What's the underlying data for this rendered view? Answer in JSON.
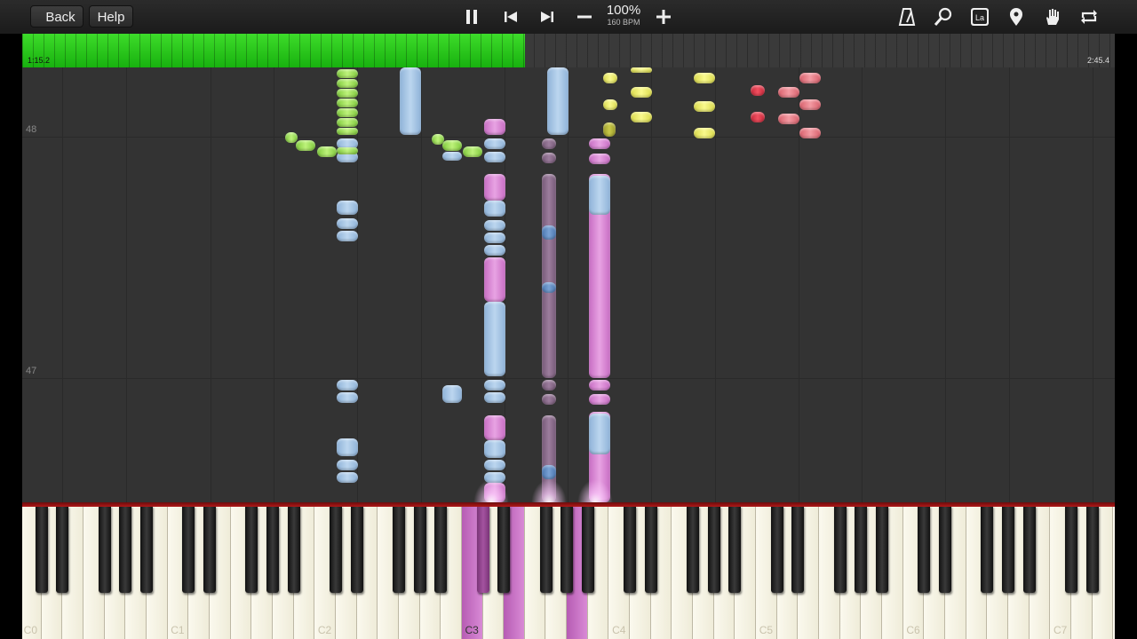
{
  "toolbar": {
    "back_label": "Back",
    "help_label": "Help",
    "tempo_percent": "100%",
    "tempo_bpm": "160 BPM",
    "icons": [
      "pause-icon",
      "skip-back-icon",
      "skip-forward-icon",
      "minus-icon",
      "plus-icon",
      "metronome-icon",
      "search-icon",
      "la-key-icon",
      "location-pin-icon",
      "hand-icon",
      "loop-icon"
    ],
    "la_label": "La"
  },
  "progress": {
    "current_time": "1:15.2",
    "total_time": "2:45.4",
    "fraction": 0.46
  },
  "roll": {
    "measure_numbers": [
      "48",
      "47"
    ]
  },
  "keyboard": {
    "octave_labels": [
      "C0",
      "C1",
      "C2",
      "C3",
      "C4",
      "C5",
      "C6",
      "C7"
    ],
    "pressed_keys": [
      "C3",
      "E3",
      "C#3",
      "A3"
    ]
  },
  "colors": {
    "progress_fill": "#2ecc1f",
    "note_blue": "#a9c7e8",
    "note_pink": "#e09ad9",
    "note_mauve": "#8a6c8b",
    "note_green": "#a6e35a",
    "note_yellow": "#f0f070",
    "note_red": "#e23a4a",
    "note_salmon": "#ea7d87",
    "keyboard_rail": "#a01414"
  }
}
